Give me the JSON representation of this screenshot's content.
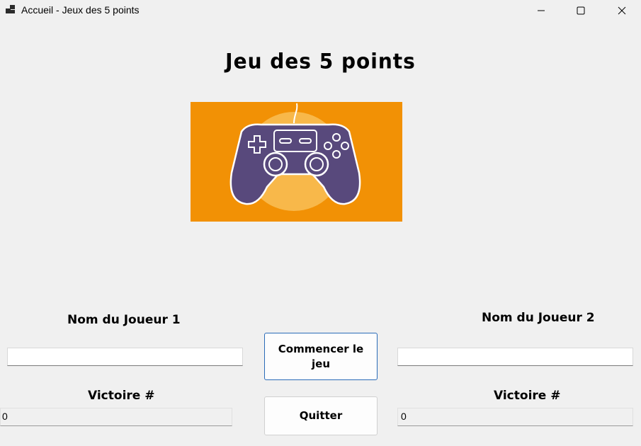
{
  "window": {
    "title": "Accueil - Jeux des 5 points",
    "icons": [
      "app-icon",
      "minimize-icon",
      "maximize-icon",
      "close-icon"
    ]
  },
  "heading": "Jeu des 5 points",
  "banner": {
    "icon": "gamepad-illustration",
    "colors": {
      "background": "#f29105",
      "circle": "#f8b84a",
      "controller": "#58497c"
    }
  },
  "player1": {
    "name_label": "Nom du Joueur 1",
    "name_value": "",
    "victory_label": "Victoire #",
    "victory_value": "0"
  },
  "player2": {
    "name_label": "Nom du Joueur 2",
    "name_value": "",
    "victory_label": "Victoire #",
    "victory_value": "0"
  },
  "buttons": {
    "start_line1": "Commencer le",
    "start_line2": "jeu",
    "quit": "Quitter"
  },
  "colors": {
    "window_bg": "#f0f0f0",
    "accent_border": "#2a6bb8"
  }
}
